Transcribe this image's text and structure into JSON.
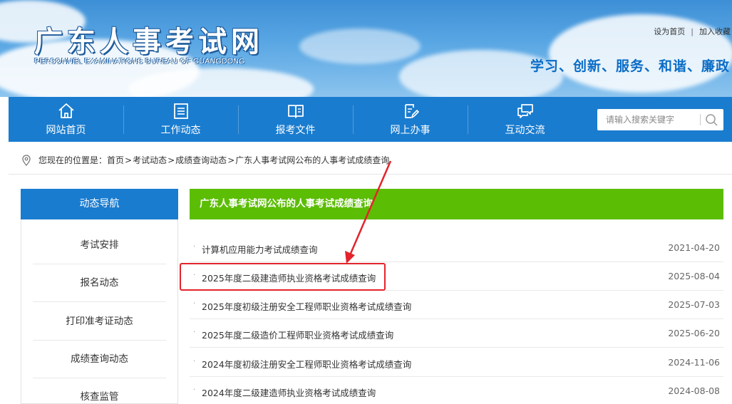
{
  "header": {
    "site_title": "广东人事考试网",
    "site_subtitle": "PERSONNEL EXAMINATIONS BUREAU OF GUANGDONG",
    "top_links": [
      "设为首页",
      "加入收藏"
    ],
    "slogan": "学习、创新、服务、和谐、廉政"
  },
  "nav": {
    "items": [
      {
        "label": "网站首页",
        "icon": "home-icon"
      },
      {
        "label": "工作动态",
        "icon": "document-list-icon"
      },
      {
        "label": "报考文件",
        "icon": "book-icon"
      },
      {
        "label": "网上办事",
        "icon": "clipboard-edit-icon"
      },
      {
        "label": "互动交流",
        "icon": "chat-icon"
      }
    ],
    "search_placeholder": "请输入搜索关键字"
  },
  "breadcrumb": {
    "prefix": "您现在的位置是：",
    "items": [
      "首页",
      "考试动态",
      "成绩查询动态",
      "广东人事考试网公布的人事考试成绩查询"
    ],
    "separator": ">"
  },
  "sidebar": {
    "header": "动态导航",
    "items": [
      {
        "label": "考试安排"
      },
      {
        "label": "报名动态"
      },
      {
        "label": "打印准考证动态"
      },
      {
        "label": "成绩查询动态"
      },
      {
        "label": "核查监管"
      }
    ]
  },
  "main": {
    "header": "广东人事考试网公布的人事考试成绩查询",
    "bullet": "·",
    "items": [
      {
        "title": "计算机应用能力考试成绩查询",
        "date": "2021-04-20"
      },
      {
        "title": "2025年度二级建造师执业资格考试成绩查询",
        "date": "2025-08-04"
      },
      {
        "title": "2025年度初级注册安全工程师职业资格考试成绩查询",
        "date": "2025-07-03"
      },
      {
        "title": "2025年度二级造价工程师职业资格考试成绩查询",
        "date": "2025-06-20"
      },
      {
        "title": "2024年度初级注册安全工程师职业资格考试成绩查询",
        "date": "2024-11-06"
      },
      {
        "title": "2024年度二级建造师执业资格考试成绩查询",
        "date": "2024-08-08"
      }
    ]
  },
  "colors": {
    "nav_blue": "#1a7ccf",
    "list_header_green": "#5cbd05",
    "annotation_red": "#e3242b",
    "slogan_blue": "#0a6cc6"
  }
}
